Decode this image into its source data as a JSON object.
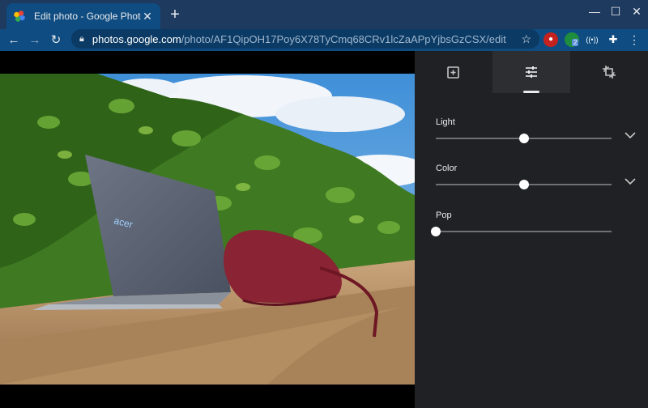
{
  "browser": {
    "tab_title": "Edit photo - Google Photos",
    "tab_close_icon": "close-icon",
    "new_tab_icon": "plus-icon",
    "window_controls": [
      "minimize-icon",
      "maximize-icon",
      "close-icon"
    ],
    "url_host": "photos.google.com",
    "url_path": "/photo/AF1QipOH17Poy6X78TyCmq68CRv1lcZaAPpYjbsGzCSX/edit",
    "extension_badge": "2",
    "colors": {
      "tabstrip": "#1e3a5f",
      "toolbar": "#0f4c81"
    }
  },
  "editor": {
    "tabs": [
      {
        "name": "auto-enhance-tab",
        "icon": "add-photo-icon",
        "active": false
      },
      {
        "name": "adjust-tab",
        "icon": "sliders-icon",
        "active": true
      },
      {
        "name": "crop-rotate-tab",
        "icon": "crop-rotate-icon",
        "active": false
      }
    ],
    "adjustments": [
      {
        "label": "Light",
        "level": 0.5,
        "expandable": true
      },
      {
        "label": "Color",
        "level": 0.5,
        "expandable": true
      },
      {
        "label": "Pop",
        "level": 0.0,
        "expandable": false
      }
    ]
  }
}
